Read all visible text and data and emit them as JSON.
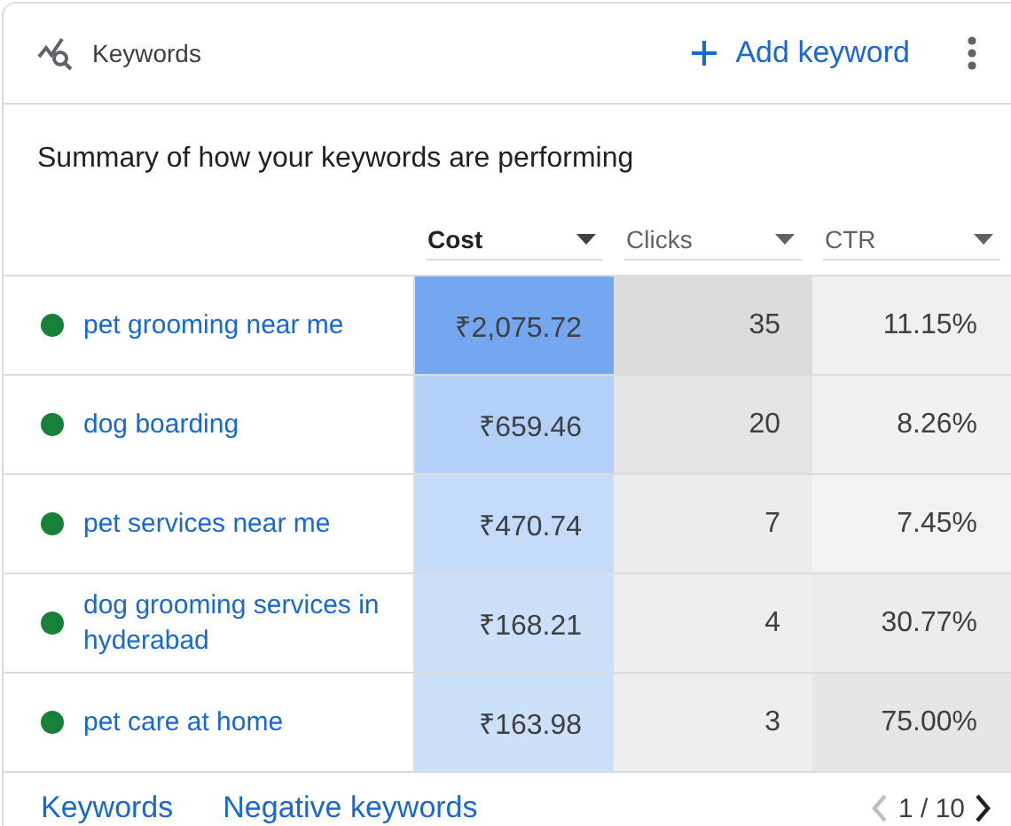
{
  "header": {
    "title": "Keywords",
    "action": "Add keyword"
  },
  "summary": "Summary of how your keywords are performing",
  "columns": [
    {
      "label": "Cost",
      "selected": true
    },
    {
      "label": "Clicks",
      "selected": false
    },
    {
      "label": "CTR",
      "selected": false
    }
  ],
  "rows": [
    {
      "keyword": "pet grooming near me",
      "color": "#188038",
      "cells": [
        {
          "text": "₹2,075.72",
          "color": "#74a7ef"
        },
        {
          "text": "35",
          "color": "#dcdcdc"
        },
        {
          "text": "11.15%",
          "color": "#f0f0f0"
        }
      ]
    },
    {
      "keyword": "dog boarding",
      "color": "#188038",
      "cells": [
        {
          "text": "₹659.46",
          "color": "#b3d0f8"
        },
        {
          "text": "20",
          "color": "#e4e4e4"
        },
        {
          "text": "8.26%",
          "color": "#f1f1f1"
        }
      ]
    },
    {
      "keyword": "pet services near me",
      "color": "#188038",
      "cells": [
        {
          "text": "₹470.74",
          "color": "#c4dbf9"
        },
        {
          "text": "7",
          "color": "#ececec"
        },
        {
          "text": "7.45%",
          "color": "#f2f2f2"
        }
      ]
    },
    {
      "keyword": "dog grooming services in hyderabad",
      "color": "#188038",
      "cells": [
        {
          "text": "₹168.21",
          "color": "#cce0fa"
        },
        {
          "text": "4",
          "color": "#eeeeee"
        },
        {
          "text": "30.77%",
          "color": "#ececec"
        }
      ]
    },
    {
      "keyword": "pet care at home",
      "color": "#188038",
      "cells": [
        {
          "text": "₹163.98",
          "color": "#cce0fa"
        },
        {
          "text": "3",
          "color": "#eeeeee"
        },
        {
          "text": "75.00%",
          "color": "#e6e6e6"
        }
      ]
    }
  ],
  "footer": {
    "links": [
      "Keywords",
      "Negative keywords"
    ],
    "page": "1 / 10",
    "prev_disabled": true,
    "next_disabled": false
  }
}
